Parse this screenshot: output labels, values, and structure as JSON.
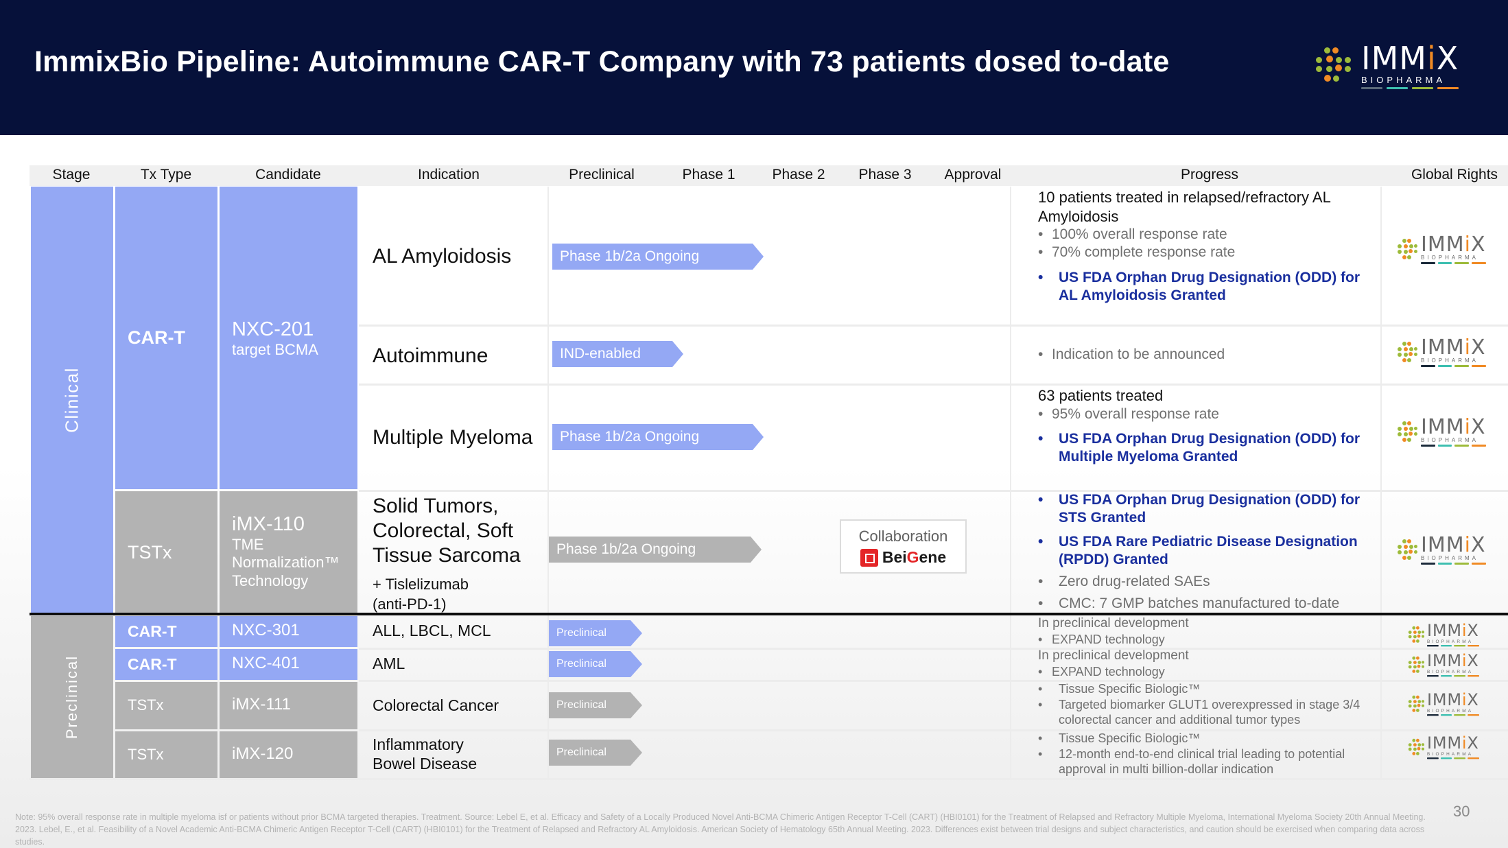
{
  "header": {
    "title": "ImmixBio Pipeline: Autoimmune CAR-T Company with 73 patients dosed to-date",
    "logo": {
      "wordmark": "IMMIX",
      "subtitle": "BIOPHARMA"
    }
  },
  "colors": {
    "header_bg": "#06113a",
    "clinical_blue": "#94a8f4",
    "tstx_grey": "#b3b3b3",
    "fda_blue": "#1a2f9e",
    "logo_orange": "#f08a24",
    "logo_green": "#9dbb3a",
    "logo_teal": "#3dbfb0",
    "logo_slate": "#5b6a7a"
  },
  "columns": {
    "stage": "Stage",
    "tx_type": "Tx Type",
    "candidate": "Candidate",
    "indication": "Indication",
    "preclinical": "Preclinical",
    "phase1": "Phase 1",
    "phase2": "Phase 2",
    "phase3": "Phase 3",
    "approval": "Approval",
    "progress": "Progress",
    "global_rights": "Global Rights"
  },
  "stages": {
    "clinical": "Clinical",
    "preclinical": "Preclinical"
  },
  "clinical": {
    "cart": {
      "tx_type": "CAR-T",
      "candidate": "NXC-201",
      "candidate_sub": "target BCMA",
      "rows": [
        {
          "indication": "AL Amyloidosis",
          "bar_label": "Phase 1b/2a Ongoing",
          "progress_head": "10 patients treated in relapsed/refractory AL Amyloidosis",
          "bullets": [
            "100% overall response rate",
            "70% complete response rate"
          ],
          "fda": [
            "US FDA Orphan Drug Designation (ODD) for AL Amyloidosis Granted"
          ]
        },
        {
          "indication": "Autoimmune",
          "bar_label": "IND-enabled",
          "bullets": [
            "Indication to be announced"
          ]
        },
        {
          "indication": "Multiple Myeloma",
          "bar_label": "Phase 1b/2a Ongoing",
          "progress_head": "63 patients treated",
          "bullets": [
            "95% overall response rate"
          ],
          "fda": [
            "US FDA Orphan Drug Designation (ODD) for Multiple Myeloma Granted"
          ]
        }
      ]
    },
    "tstx": {
      "tx_type": "TSTx",
      "candidate": "iMX-110",
      "candidate_sub": [
        "TME",
        "Normalization™",
        "Technology"
      ],
      "indication": [
        "Solid Tumors,",
        "Colorectal, Soft",
        "Tissue Sarcoma"
      ],
      "indication_sub": [
        "+ Tislelizumab",
        "(anti-PD-1)"
      ],
      "bar_label": "Phase 1b/2a Ongoing",
      "collaboration": {
        "label": "Collaboration",
        "partner": "BeiGene"
      },
      "fda": [
        "US FDA Orphan Drug Designation (ODD) for STS Granted",
        "US FDA Rare Pediatric Disease Designation (RPDD) Granted"
      ],
      "bullets": [
        "Zero drug-related SAEs",
        "CMC: 7 GMP batches manufactured to-date"
      ]
    }
  },
  "preclinical": [
    {
      "tx_type": "CAR-T",
      "candidate": "NXC-301",
      "indication": "ALL, LBCL, MCL",
      "bar_label": "Preclinical",
      "progress_head": "In preclinical development",
      "bullets": [
        "EXPAND technology"
      ]
    },
    {
      "tx_type": "CAR-T",
      "candidate": "NXC-401",
      "indication": "AML",
      "bar_label": "Preclinical",
      "progress_head": "In preclinical development",
      "bullets": [
        "EXPAND technology"
      ]
    },
    {
      "tx_type": "TSTx",
      "candidate": "iMX-111",
      "indication": "Colorectal Cancer",
      "bar_label": "Preclinical",
      "bullets": [
        "Tissue Specific Biologic™",
        "Targeted biomarker GLUT1 overexpressed in stage 3/4 colorectal cancer and additional tumor types"
      ]
    },
    {
      "tx_type": "TSTx",
      "candidate": "iMX-120",
      "indication": [
        "Inflammatory",
        "Bowel Disease"
      ],
      "bar_label": "Preclinical",
      "bullets": [
        "Tissue Specific Biologic™",
        "12-month end-to-end clinical trial leading to potential approval in multi billion-dollar indication"
      ]
    }
  ],
  "global_rights_logo": {
    "wordmark": "IMMIX",
    "subtitle": "BIOPHARMA"
  },
  "footer": {
    "note": "Note: 95% overall response rate in multiple myeloma isf or patients without prior BCMA targeted therapies. Treatment. Source: Lebel E, et al. Efficacy and Safety of a Locally Produced Novel Anti-BCMA Chimeric Antigen Receptor T-Cell (CART) (HBI0101) for the Treatment of Relapsed and Refractory Multiple Myeloma, International Myeloma Society 20th Annual Meeting. 2023. Lebel, E., et al. Feasibility of a Novel Academic Anti-BCMA Chimeric Antigen Receptor T-Cell (CART) (HBI0101) for the Treatment of Relapsed and Refractory AL Amyloidosis. American Society of Hematology 65th Annual Meeting. 2023. Differences exist between trial designs and subject characteristics, and caution should be exercised when comparing data across studies.",
    "page_number": "30"
  }
}
